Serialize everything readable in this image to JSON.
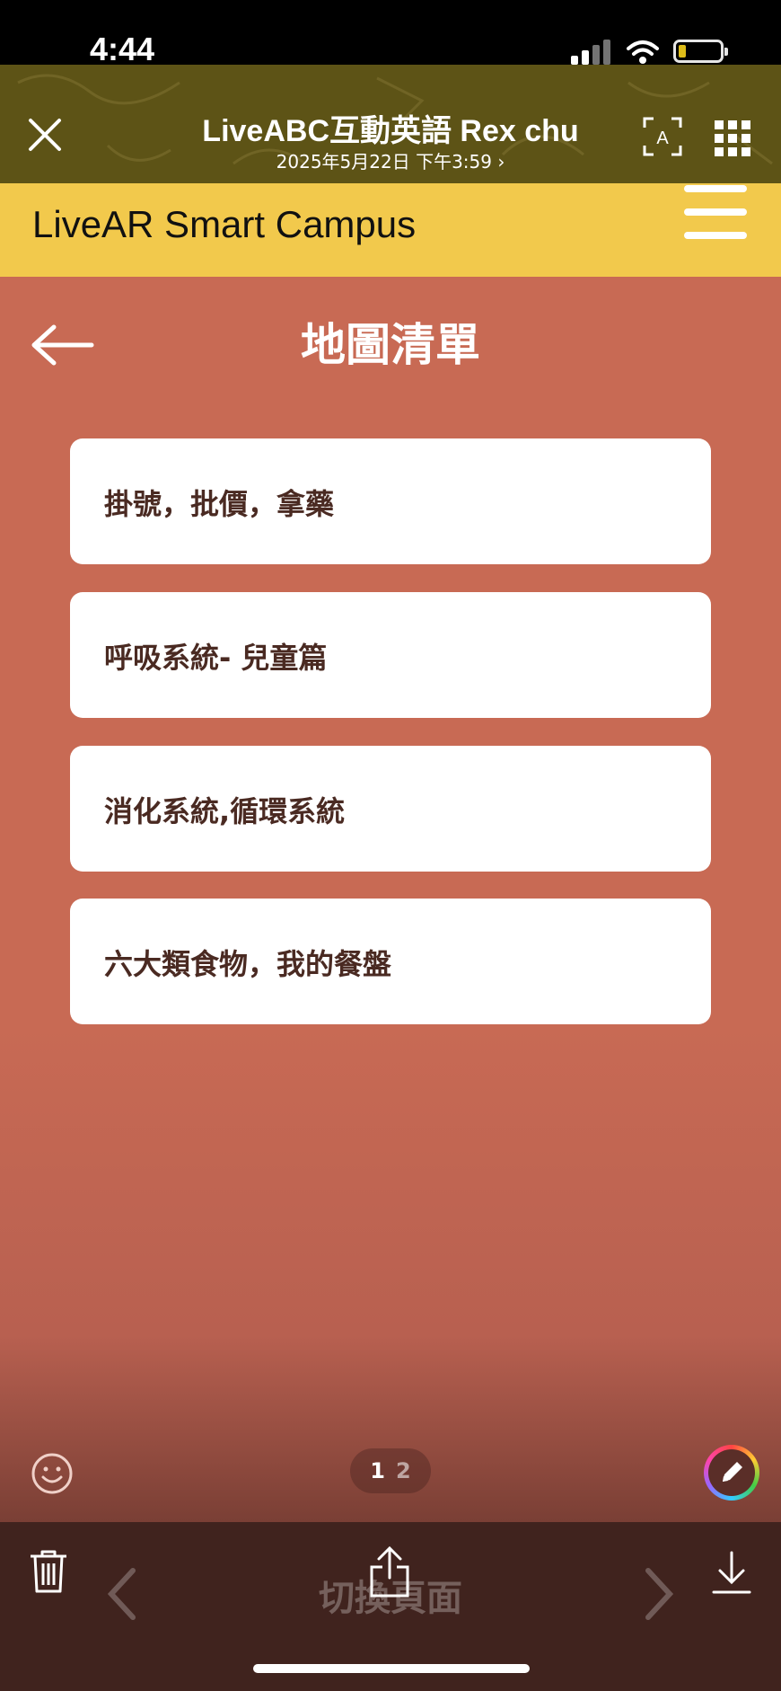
{
  "status_bar": {
    "time": "4:44"
  },
  "viewer": {
    "title": "LiveABC互動英語  Rex chu",
    "subtitle": "2025年5月22日 下午3:59 ›"
  },
  "app": {
    "name": "LiveAR Smart Campus"
  },
  "page": {
    "title": "地圖清單"
  },
  "map_list": [
    {
      "label": "掛號，批價，拿藥"
    },
    {
      "label": "呼吸系統- 兒童篇"
    },
    {
      "label": "消化系統,循環系統"
    },
    {
      "label": "六大類食物，我的餐盤"
    }
  ],
  "pager": {
    "current": "1",
    "other": "2"
  },
  "toolbar": {
    "ghost_label": "切換頁面"
  },
  "colors": {
    "header": "#5d5316",
    "banner": "#f2c94c",
    "background": "#c86a54",
    "toolbar": "#40231e",
    "card_text": "#4a2a22"
  }
}
